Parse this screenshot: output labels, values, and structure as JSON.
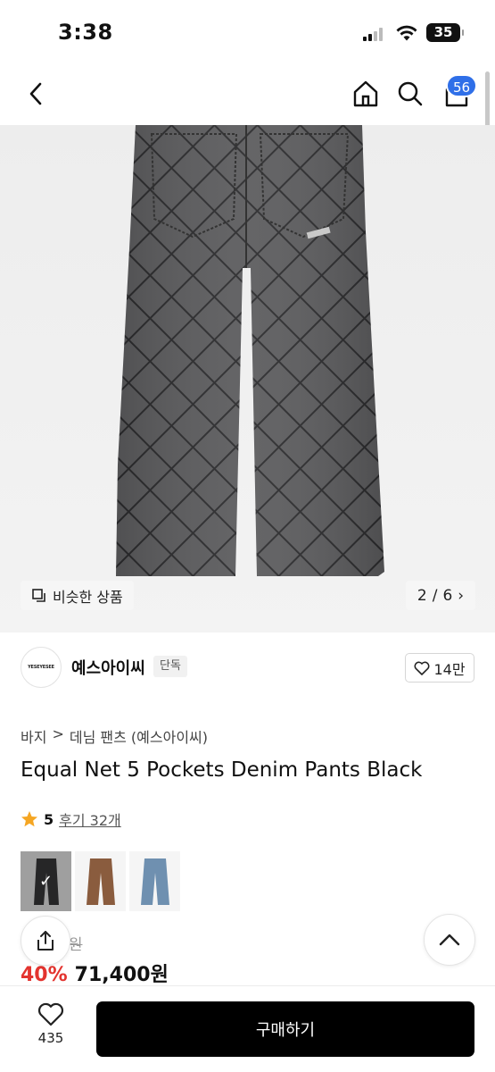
{
  "status_bar": {
    "time": "3:38",
    "battery": "35"
  },
  "nav": {
    "cart_badge": "56"
  },
  "gallery": {
    "similar_label": "비슷한 상품",
    "page_current": "2",
    "page_total": "6",
    "page_separator": "/",
    "next_chevron": "›"
  },
  "brand": {
    "logo_text": "YESEYESEE",
    "name": "예스아이씨",
    "tag": "단독",
    "like_count": "14만"
  },
  "breadcrumb": {
    "level1": "바지",
    "separator": ">",
    "level2": "데님 팬츠 (예스아이씨)"
  },
  "product": {
    "title": "Equal Net 5 Pockets Denim Pants Black",
    "rating": "5",
    "review_label": "후기 32개",
    "original_price_visible": "0원",
    "discount": "40%",
    "price": "71,400원"
  },
  "color_options": [
    {
      "name": "black",
      "selected": true,
      "color": "#3b3b3d"
    },
    {
      "name": "brown",
      "selected": false,
      "color": "#8a5c3e"
    },
    {
      "name": "blue",
      "selected": false,
      "color": "#6f90b0"
    }
  ],
  "bottom_bar": {
    "wish_count": "435",
    "buy_label": "구매하기"
  },
  "colors": {
    "accent_badge": "#2f6fe8",
    "discount_red": "#e3342f",
    "star": "#f5a623",
    "buy_bg": "#000000"
  }
}
